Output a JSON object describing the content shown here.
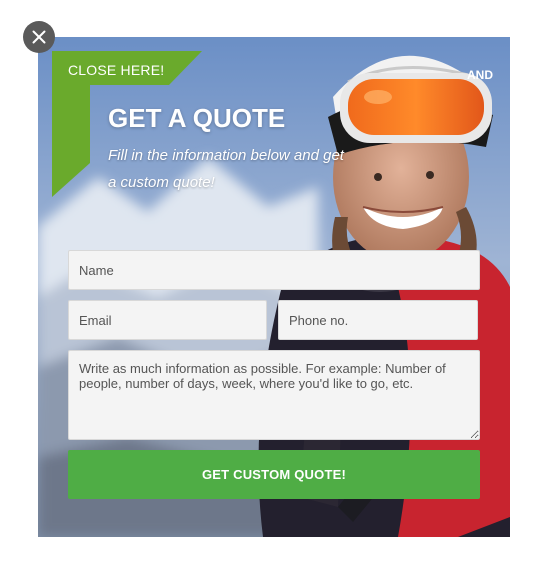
{
  "close_icon": "close-icon",
  "popup": {
    "close_here": "CLOSE HERE!",
    "title": "GET A QUOTE",
    "subtitle": "Fill in the information below and get a custom quote!",
    "goggle_brand": "AND",
    "form": {
      "name_placeholder": "Name",
      "email_placeholder": "Email",
      "phone_placeholder": "Phone no.",
      "message_placeholder": "Write as much information as possible. For example: Number of people, number of days, week, where you'd like to go, etc.",
      "submit_label": "GET CUSTOM QUOTE!"
    }
  },
  "colors": {
    "accent_green": "#6aaa2c",
    "button_green": "#4fad45",
    "close_button": "#5a5a5a"
  }
}
